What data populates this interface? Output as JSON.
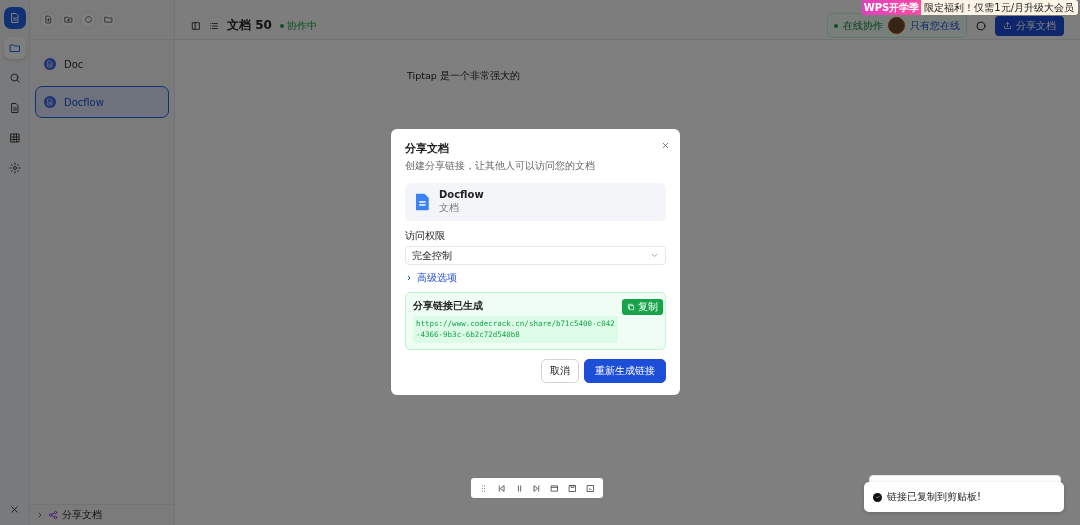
{
  "rail": [
    {
      "kind": "folder",
      "selected": true
    },
    {
      "kind": "search",
      "selected": false
    },
    {
      "kind": "document",
      "selected": false
    },
    {
      "kind": "grid",
      "selected": false
    },
    {
      "kind": "settings",
      "selected": false
    }
  ],
  "sidebar": {
    "items": [
      {
        "label": "Doc",
        "selected": false
      },
      {
        "label": "Docflow",
        "selected": true
      }
    ],
    "footer": "分享文档"
  },
  "header": {
    "title": "文档 50",
    "status": "协作中",
    "online": "在线协作",
    "online_note": "只有您在线",
    "share_button": "分享文档"
  },
  "banner": {
    "badge": "WPS开学季",
    "text": "限定福利！仅需1元/月升级大会员"
  },
  "editor": {
    "text": "Tiptap 是一个非常强大的"
  },
  "dialog": {
    "title": "分享文档",
    "subtitle": "创建分享链接，让其他人可以访问您的文档",
    "doc_name": "Docflow",
    "doc_type": "文档",
    "permission_label": "访问权限",
    "permission_value": "完全控制",
    "advanced": {
      "label": "高级选项",
      "expanded": false
    },
    "link_title": "分享链接已生成",
    "link_url": "https://www.codecrack.cn/share/b71c5400-c042-4366-9b3c-6b2c72d540b8",
    "copy_button": "复制",
    "buttons": [
      "取消",
      "重新生成链接"
    ]
  },
  "toasts": [
    {
      "text": "链接已复制到剪贴板!"
    }
  ]
}
